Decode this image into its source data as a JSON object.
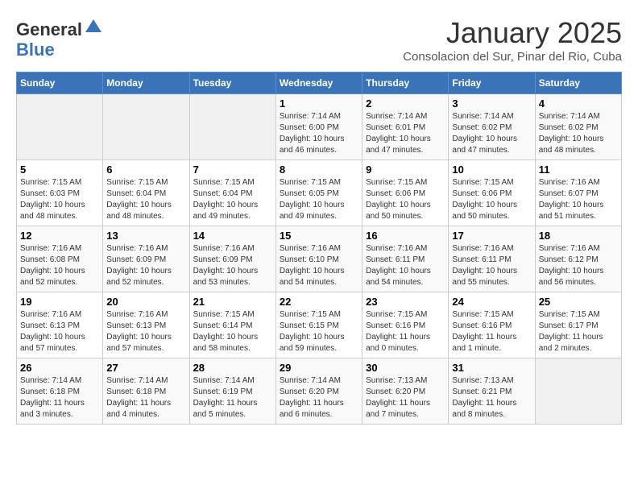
{
  "header": {
    "logo_line1": "General",
    "logo_line2": "Blue",
    "month": "January 2025",
    "subtitle": "Consolacion del Sur, Pinar del Rio, Cuba"
  },
  "days_of_week": [
    "Sunday",
    "Monday",
    "Tuesday",
    "Wednesday",
    "Thursday",
    "Friday",
    "Saturday"
  ],
  "weeks": [
    [
      {
        "day": "",
        "info": ""
      },
      {
        "day": "",
        "info": ""
      },
      {
        "day": "",
        "info": ""
      },
      {
        "day": "1",
        "info": "Sunrise: 7:14 AM\nSunset: 6:00 PM\nDaylight: 10 hours\nand 46 minutes."
      },
      {
        "day": "2",
        "info": "Sunrise: 7:14 AM\nSunset: 6:01 PM\nDaylight: 10 hours\nand 47 minutes."
      },
      {
        "day": "3",
        "info": "Sunrise: 7:14 AM\nSunset: 6:02 PM\nDaylight: 10 hours\nand 47 minutes."
      },
      {
        "day": "4",
        "info": "Sunrise: 7:14 AM\nSunset: 6:02 PM\nDaylight: 10 hours\nand 48 minutes."
      }
    ],
    [
      {
        "day": "5",
        "info": "Sunrise: 7:15 AM\nSunset: 6:03 PM\nDaylight: 10 hours\nand 48 minutes."
      },
      {
        "day": "6",
        "info": "Sunrise: 7:15 AM\nSunset: 6:04 PM\nDaylight: 10 hours\nand 48 minutes."
      },
      {
        "day": "7",
        "info": "Sunrise: 7:15 AM\nSunset: 6:04 PM\nDaylight: 10 hours\nand 49 minutes."
      },
      {
        "day": "8",
        "info": "Sunrise: 7:15 AM\nSunset: 6:05 PM\nDaylight: 10 hours\nand 49 minutes."
      },
      {
        "day": "9",
        "info": "Sunrise: 7:15 AM\nSunset: 6:06 PM\nDaylight: 10 hours\nand 50 minutes."
      },
      {
        "day": "10",
        "info": "Sunrise: 7:15 AM\nSunset: 6:06 PM\nDaylight: 10 hours\nand 50 minutes."
      },
      {
        "day": "11",
        "info": "Sunrise: 7:16 AM\nSunset: 6:07 PM\nDaylight: 10 hours\nand 51 minutes."
      }
    ],
    [
      {
        "day": "12",
        "info": "Sunrise: 7:16 AM\nSunset: 6:08 PM\nDaylight: 10 hours\nand 52 minutes."
      },
      {
        "day": "13",
        "info": "Sunrise: 7:16 AM\nSunset: 6:09 PM\nDaylight: 10 hours\nand 52 minutes."
      },
      {
        "day": "14",
        "info": "Sunrise: 7:16 AM\nSunset: 6:09 PM\nDaylight: 10 hours\nand 53 minutes."
      },
      {
        "day": "15",
        "info": "Sunrise: 7:16 AM\nSunset: 6:10 PM\nDaylight: 10 hours\nand 54 minutes."
      },
      {
        "day": "16",
        "info": "Sunrise: 7:16 AM\nSunset: 6:11 PM\nDaylight: 10 hours\nand 54 minutes."
      },
      {
        "day": "17",
        "info": "Sunrise: 7:16 AM\nSunset: 6:11 PM\nDaylight: 10 hours\nand 55 minutes."
      },
      {
        "day": "18",
        "info": "Sunrise: 7:16 AM\nSunset: 6:12 PM\nDaylight: 10 hours\nand 56 minutes."
      }
    ],
    [
      {
        "day": "19",
        "info": "Sunrise: 7:16 AM\nSunset: 6:13 PM\nDaylight: 10 hours\nand 57 minutes."
      },
      {
        "day": "20",
        "info": "Sunrise: 7:16 AM\nSunset: 6:13 PM\nDaylight: 10 hours\nand 57 minutes."
      },
      {
        "day": "21",
        "info": "Sunrise: 7:15 AM\nSunset: 6:14 PM\nDaylight: 10 hours\nand 58 minutes."
      },
      {
        "day": "22",
        "info": "Sunrise: 7:15 AM\nSunset: 6:15 PM\nDaylight: 10 hours\nand 59 minutes."
      },
      {
        "day": "23",
        "info": "Sunrise: 7:15 AM\nSunset: 6:16 PM\nDaylight: 11 hours\nand 0 minutes."
      },
      {
        "day": "24",
        "info": "Sunrise: 7:15 AM\nSunset: 6:16 PM\nDaylight: 11 hours\nand 1 minute."
      },
      {
        "day": "25",
        "info": "Sunrise: 7:15 AM\nSunset: 6:17 PM\nDaylight: 11 hours\nand 2 minutes."
      }
    ],
    [
      {
        "day": "26",
        "info": "Sunrise: 7:14 AM\nSunset: 6:18 PM\nDaylight: 11 hours\nand 3 minutes."
      },
      {
        "day": "27",
        "info": "Sunrise: 7:14 AM\nSunset: 6:18 PM\nDaylight: 11 hours\nand 4 minutes."
      },
      {
        "day": "28",
        "info": "Sunrise: 7:14 AM\nSunset: 6:19 PM\nDaylight: 11 hours\nand 5 minutes."
      },
      {
        "day": "29",
        "info": "Sunrise: 7:14 AM\nSunset: 6:20 PM\nDaylight: 11 hours\nand 6 minutes."
      },
      {
        "day": "30",
        "info": "Sunrise: 7:13 AM\nSunset: 6:20 PM\nDaylight: 11 hours\nand 7 minutes."
      },
      {
        "day": "31",
        "info": "Sunrise: 7:13 AM\nSunset: 6:21 PM\nDaylight: 11 hours\nand 8 minutes."
      },
      {
        "day": "",
        "info": ""
      }
    ]
  ]
}
